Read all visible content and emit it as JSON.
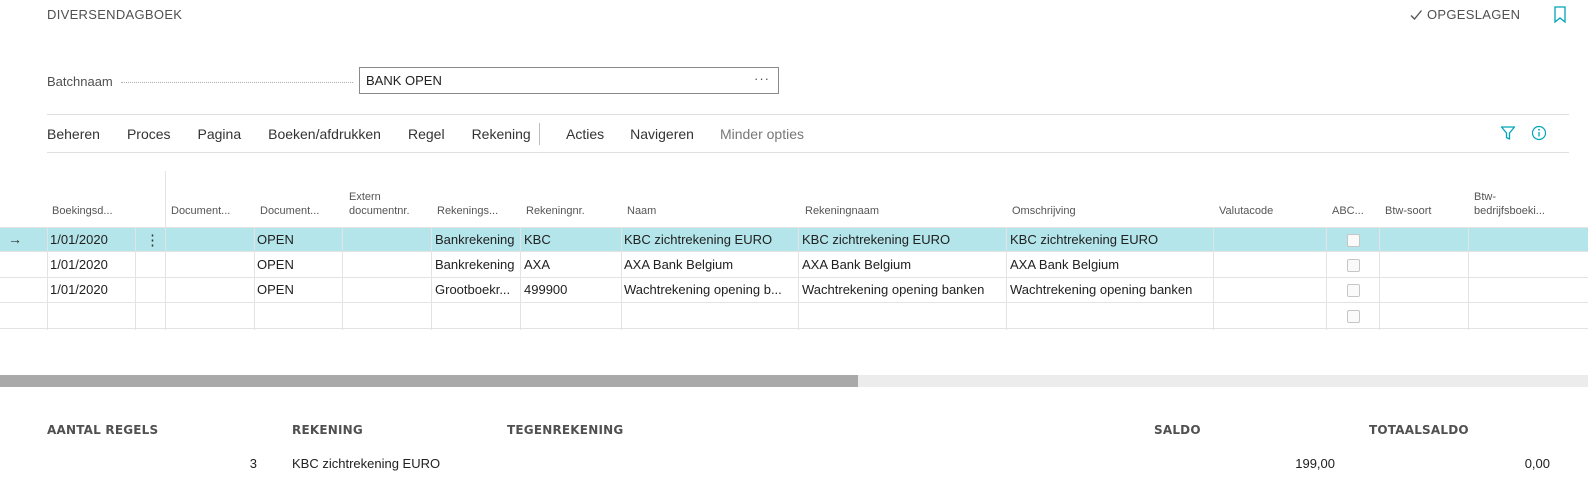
{
  "header": {
    "title": "DIVERSENDAGBOEK",
    "saved_label": "OPGESLAGEN"
  },
  "batch": {
    "label": "Batchnaam",
    "value": "BANK OPEN",
    "ellipsis": "···"
  },
  "menu": {
    "items": [
      "Beheren",
      "Proces",
      "Pagina",
      "Boeken/afdrukken",
      "Regel",
      "Rekening"
    ],
    "items2": [
      "Acties",
      "Navigeren"
    ],
    "less_options": "Minder opties"
  },
  "columns": {
    "boekingsdatum": "Boekingsd...",
    "doc_type": "Document...",
    "doc_nr": "Document...",
    "extern_1": "Extern",
    "extern_2": "documentnr.",
    "rek_soort": "Rekenings...",
    "rek_nr": "Rekeningnr.",
    "naam": "Naam",
    "rek_naam": "Rekeningnaam",
    "omschrijving": "Omschrijving",
    "valuta": "Valutacode",
    "abc": "ABC...",
    "btw_soort": "Btw-soort",
    "btw_bedrijf_1": "Btw-",
    "btw_bedrijf_2": "bedrijfsboeki..."
  },
  "rows": [
    {
      "datum": "1/01/2020",
      "docnr": "OPEN",
      "soort": "Bankrekening",
      "reknr": "KBC",
      "naam": "KBC zichtrekening EURO",
      "reknaam": "KBC zichtrekening EURO",
      "omschrijving": "KBC zichtrekening EURO"
    },
    {
      "datum": "1/01/2020",
      "docnr": "OPEN",
      "soort": "Bankrekening",
      "reknr": "AXA",
      "naam": "AXA Bank Belgium",
      "reknaam": "AXA Bank Belgium",
      "omschrijving": "AXA Bank Belgium"
    },
    {
      "datum": "1/01/2020",
      "docnr": "OPEN",
      "soort": "Grootboekr...",
      "reknr": "499900",
      "naam": "Wachtrekening opening b...",
      "reknaam": "Wachtrekening opening banken",
      "omschrijving": "Wachtrekening opening banken"
    }
  ],
  "row_marker": "→",
  "row_menu": "⋮",
  "footer": {
    "aantal_label": "AANTAL REGELS",
    "rekening_label": "REKENING",
    "tegen_label": "TEGENREKENING",
    "saldo_label": "SALDO",
    "totaal_label": "TOTAALSALDO",
    "aantal_value": "3",
    "rekening_value": "KBC zichtrekening EURO",
    "saldo_value": "199,00",
    "totaal_value": "0,00"
  },
  "scrollbar": {
    "horizontal_position": 0.0,
    "visible_fraction": 0.54
  },
  "colors": {
    "selected_row": "#b4e5ea",
    "accent": "#00a5b8"
  }
}
